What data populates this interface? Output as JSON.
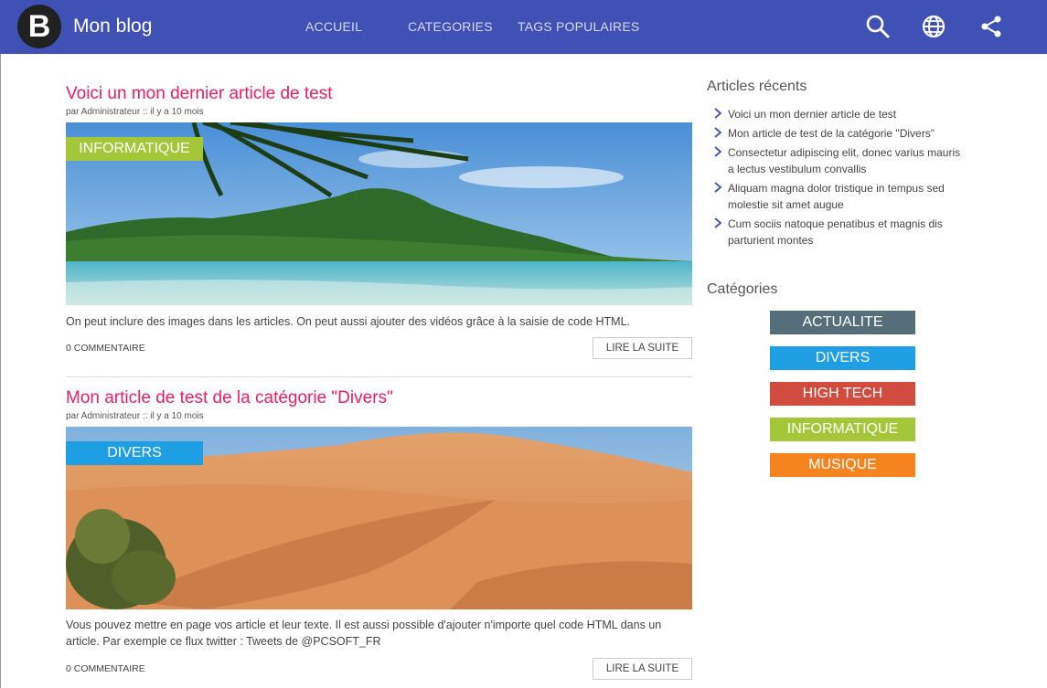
{
  "header": {
    "logo_letter": "B",
    "brand": "Mon blog",
    "nav": [
      "ACCUEIL",
      "CATEGORIES",
      "TAGS POPULAIRES"
    ],
    "icons": [
      "search-icon",
      "globe-icon",
      "share-icon"
    ],
    "color": "#3f51b5"
  },
  "posts": [
    {
      "title": "Voici un mon dernier article de test",
      "meta": "par Administrateur :: il y a 10 mois",
      "category": "INFORMATIQUE",
      "category_color": "#a4c639",
      "text": "On peut inclure des images dans les articles. On peut aussi ajouter des vidéos grâce à la saisie de code HTML.",
      "comments": "0 COMMENTAIRE",
      "read_more": "LIRE LA SUITE"
    },
    {
      "title": "Mon article de test de la catégorie \"Divers\"",
      "meta": "par Administrateur :: il y a 10 mois",
      "category": "DIVERS",
      "category_color": "#1e9fe3",
      "text": "Vous pouvez mettre en page vos article et leur texte. Il est aussi possible d'ajouter n'importe quel code HTML dans un article.  Par exemple ce flux twitter : Tweets de @PCSOFT_FR",
      "comments": "0 COMMENTAIRE",
      "read_more": "LIRE LA SUITE"
    }
  ],
  "sidebar": {
    "recent_title": "Articles récents",
    "recent": [
      "Voici un mon dernier article de test",
      "Mon article de test de la catégorie \"Divers\"",
      "Consectetur adipiscing elit, donec varius mauris a lectus vestibulum convallis",
      "Aliquam magna dolor tristique in tempus sed molestie sit amet augue",
      "Cum sociis natoque penatibus et magnis dis parturient montes"
    ],
    "categories_title": "Catégories",
    "categories": [
      {
        "label": "ACTUALITE",
        "color": "#546e7a"
      },
      {
        "label": "DIVERS",
        "color": "#1e9fe3"
      },
      {
        "label": "HIGH TECH",
        "color": "#d24b3f"
      },
      {
        "label": "INFORMATIQUE",
        "color": "#a4c639"
      },
      {
        "label": "MUSIQUE",
        "color": "#f5841f"
      }
    ]
  }
}
